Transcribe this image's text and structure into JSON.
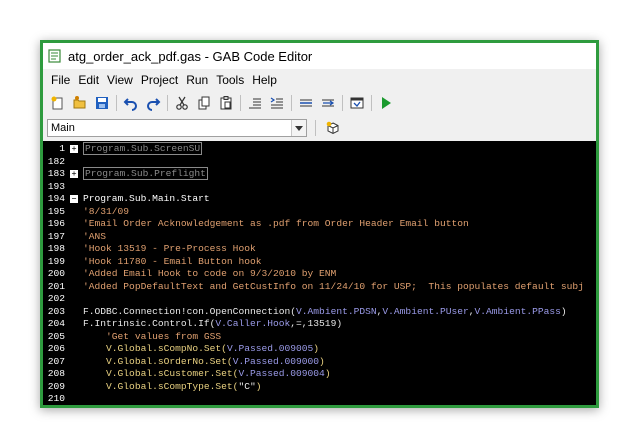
{
  "window": {
    "title": "atg_order_ack_pdf.gas - GAB Code Editor"
  },
  "menu": [
    "File",
    "Edit",
    "View",
    "Project",
    "Run",
    "Tools",
    "Help"
  ],
  "toolbar": {
    "icons": [
      "new-icon",
      "open-icon",
      "save-icon",
      "undo-icon",
      "redo-icon",
      "cut-icon",
      "copy-icon",
      "paste-icon",
      "outdent-icon",
      "indent-icon",
      "comment-icon",
      "uncomment-icon",
      "properties-icon",
      "run-icon"
    ]
  },
  "selector": {
    "value": "Main"
  },
  "editor": {
    "lines": [
      {
        "n": "1",
        "fold": "+",
        "segments": [
          {
            "t": "Program.Sub.ScreenSU",
            "c": "collapsed"
          }
        ]
      },
      {
        "n": "182",
        "segments": []
      },
      {
        "n": "183",
        "fold": "+",
        "segments": [
          {
            "t": "Program.Sub.Preflight",
            "c": "collapsed"
          }
        ]
      },
      {
        "n": "193",
        "segments": []
      },
      {
        "n": "194",
        "fold": "−",
        "segments": [
          {
            "t": "Program.Sub.Main.Start",
            "c": "hdr"
          }
        ]
      },
      {
        "n": "195",
        "segments": [
          {
            "t": "'8/31/09",
            "c": "comment"
          }
        ]
      },
      {
        "n": "196",
        "segments": [
          {
            "t": "'Email Order Acknowledgement as .pdf from Order Header Email button",
            "c": "comment"
          }
        ]
      },
      {
        "n": "197",
        "segments": [
          {
            "t": "'ANS",
            "c": "comment"
          }
        ]
      },
      {
        "n": "198",
        "segments": [
          {
            "t": "'Hook 13519 - Pre-Process Hook",
            "c": "comment"
          }
        ]
      },
      {
        "n": "199",
        "segments": [
          {
            "t": "'Hook 11780 - Email Button hook",
            "c": "comment"
          }
        ]
      },
      {
        "n": "200",
        "segments": [
          {
            "t": "'Added Email Hook to code on 9/3/2010 by ENM",
            "c": "comment"
          }
        ]
      },
      {
        "n": "201",
        "segments": [
          {
            "t": "'Added PopDefaultText and GetCustInfo on 11/24/10 for USP;  This populates default subj",
            "c": "comment"
          }
        ]
      },
      {
        "n": "202",
        "segments": []
      },
      {
        "n": "203",
        "segments": [
          {
            "t": "F.ODBC.Connection!con.OpenConnection(",
            "c": "kw"
          },
          {
            "t": "V.Ambient.PDSN",
            "c": "var"
          },
          {
            "t": ",",
            "c": "kw"
          },
          {
            "t": "V.Ambient.PUser",
            "c": "var"
          },
          {
            "t": ",",
            "c": "kw"
          },
          {
            "t": "V.Ambient.PPass",
            "c": "var"
          },
          {
            "t": ")",
            "c": "kw"
          }
        ]
      },
      {
        "n": "204",
        "segments": [
          {
            "t": "F.Intrinsic.Control.If(",
            "c": "kw"
          },
          {
            "t": "V.Caller.Hook",
            "c": "var"
          },
          {
            "t": ",=,13519)",
            "c": "kw"
          }
        ]
      },
      {
        "n": "205",
        "segments": [
          {
            "t": "    'Get values from GSS",
            "c": "comment"
          }
        ]
      },
      {
        "n": "206",
        "segments": [
          {
            "t": "    V.Global.sCompNo.Set(",
            "c": "str"
          },
          {
            "t": "V.Passed.009005",
            "c": "var"
          },
          {
            "t": ")",
            "c": "str"
          }
        ]
      },
      {
        "n": "207",
        "segments": [
          {
            "t": "    V.Global.sOrderNo.Set(",
            "c": "str"
          },
          {
            "t": "V.Passed.009000",
            "c": "var"
          },
          {
            "t": ")",
            "c": "str"
          }
        ]
      },
      {
        "n": "208",
        "segments": [
          {
            "t": "    V.Global.sCustomer.Set(",
            "c": "str"
          },
          {
            "t": "V.Passed.009004",
            "c": "var"
          },
          {
            "t": ")",
            "c": "str"
          }
        ]
      },
      {
        "n": "209",
        "segments": [
          {
            "t": "    V.Global.sCompType.Set(",
            "c": "str"
          },
          {
            "t": "\"C\"",
            "c": "kw"
          },
          {
            "t": ")",
            "c": "str"
          }
        ]
      },
      {
        "n": "210",
        "segments": []
      }
    ]
  }
}
